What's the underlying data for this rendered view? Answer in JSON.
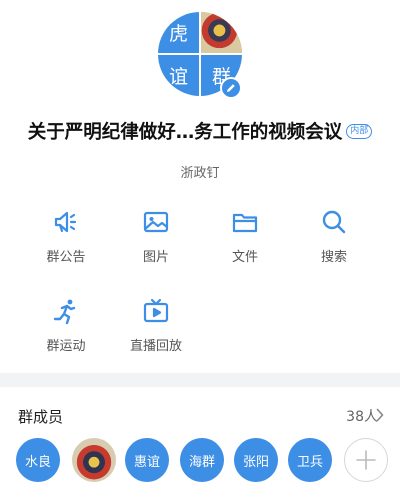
{
  "group": {
    "avatar_chars": [
      "虎",
      "谊",
      "群"
    ],
    "title": "关于严明纪律做好…务工作的视频会议",
    "tag": "内部",
    "org": "浙政钉"
  },
  "functions": [
    {
      "label": "群公告",
      "icon": "megaphone-icon"
    },
    {
      "label": "图片",
      "icon": "image-icon"
    },
    {
      "label": "文件",
      "icon": "folder-icon"
    },
    {
      "label": "搜索",
      "icon": "search-icon"
    },
    {
      "label": "群运动",
      "icon": "running-icon"
    },
    {
      "label": "直播回放",
      "icon": "tv-playback-icon"
    }
  ],
  "members": {
    "title": "群成员",
    "count": "38人",
    "list": [
      "水良",
      "",
      "惠谊",
      "海群",
      "张阳",
      "卫兵"
    ]
  },
  "colors": {
    "accent": "#3d8ee5",
    "divider": "#f2f3f5"
  }
}
